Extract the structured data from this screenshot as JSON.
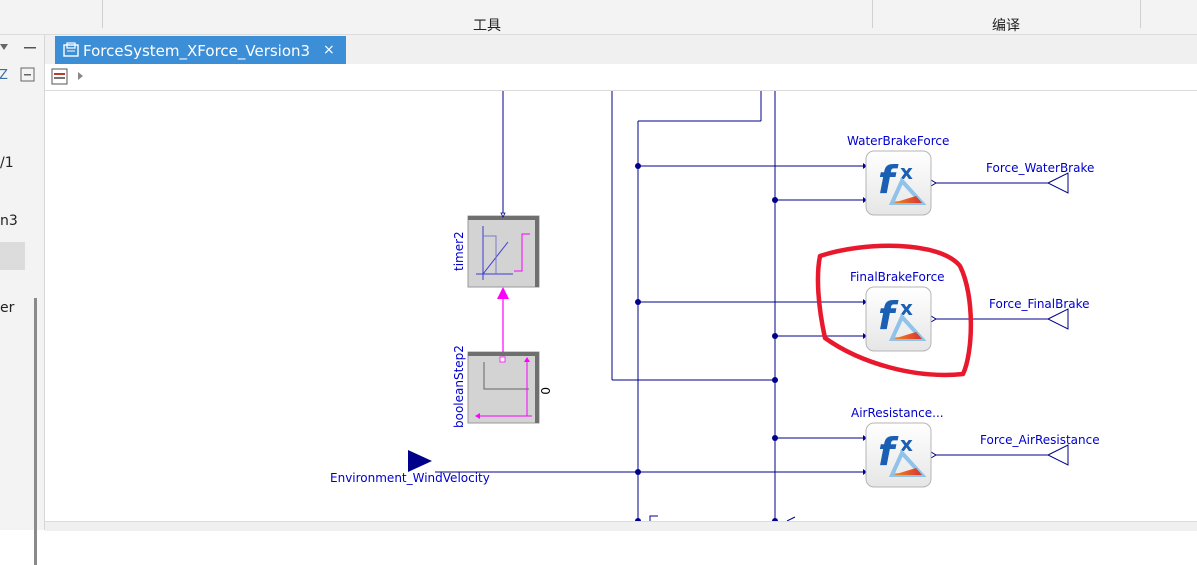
{
  "menubar": {
    "tools_label": "工具",
    "compile_label": "编译"
  },
  "left_panel": {
    "frag_1": "/1",
    "frag_2": "n3",
    "frag_3": "er"
  },
  "tab": {
    "title": "ForceSystem_XForce_Version3",
    "close_glyph": "×"
  },
  "diagram": {
    "timer_label": "timer2",
    "boolean_step_label": "booleanStep2",
    "boolean_step_param": "0",
    "water_brake_block": "WaterBrakeForce",
    "final_brake_block": "FinalBrakeForce",
    "air_resistance_block": "AirResistance...",
    "water_brake_output": "Force_WaterBrake",
    "final_brake_output": "Force_FinalBrake",
    "air_resistance_output": "Force_AirResistance",
    "wind_input": "Environment_WindVelocity"
  },
  "colors": {
    "connection": "#00008b",
    "boolean_connection": "#ff00ff",
    "label": "#0000cd",
    "highlight": "#e8192c",
    "tab_active": "#3c8ed6"
  },
  "icons": [
    "save-diagram-icon",
    "play-triangle-icon",
    "function-block-icon",
    "output-connector-icon",
    "input-connector-icon",
    "close-icon"
  ]
}
